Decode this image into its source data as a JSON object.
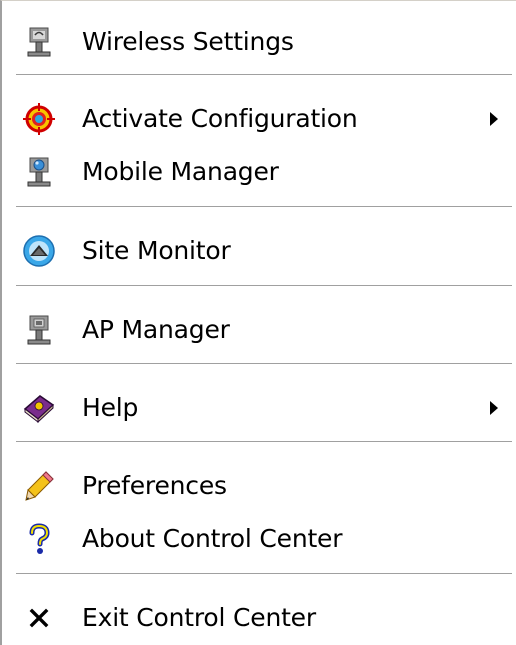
{
  "menu": {
    "items": [
      {
        "label": "Wireless Settings",
        "icon": "wireless-settings-icon",
        "submenu": false
      },
      {
        "label": "Activate Configuration",
        "icon": "target-icon",
        "submenu": true
      },
      {
        "label": "Mobile Manager",
        "icon": "mobile-manager-icon",
        "submenu": false
      },
      {
        "label": "Site Monitor",
        "icon": "site-monitor-icon",
        "submenu": false
      },
      {
        "label": "AP Manager",
        "icon": "ap-manager-icon",
        "submenu": false
      },
      {
        "label": "Help",
        "icon": "help-book-icon",
        "submenu": true
      },
      {
        "label": "Preferences",
        "icon": "pencil-icon",
        "submenu": false
      },
      {
        "label": "About Control Center",
        "icon": "question-mark-icon",
        "submenu": false
      },
      {
        "label": "Exit Control Center",
        "icon": "close-x-icon",
        "submenu": false
      }
    ]
  },
  "colors": {
    "menu_background": "#ffffff",
    "separator": "#a0a0a0",
    "text": "#000000"
  }
}
